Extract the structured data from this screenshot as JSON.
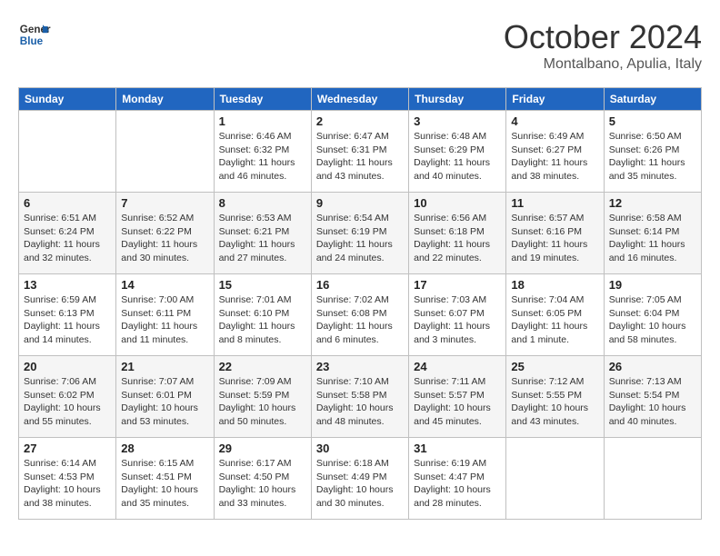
{
  "header": {
    "logo_line1": "General",
    "logo_line2": "Blue",
    "month": "October 2024",
    "location": "Montalbano, Apulia, Italy"
  },
  "days_of_week": [
    "Sunday",
    "Monday",
    "Tuesday",
    "Wednesday",
    "Thursday",
    "Friday",
    "Saturday"
  ],
  "weeks": [
    [
      {
        "day": "",
        "info": ""
      },
      {
        "day": "",
        "info": ""
      },
      {
        "day": "1",
        "info": "Sunrise: 6:46 AM\nSunset: 6:32 PM\nDaylight: 11 hours and 46 minutes."
      },
      {
        "day": "2",
        "info": "Sunrise: 6:47 AM\nSunset: 6:31 PM\nDaylight: 11 hours and 43 minutes."
      },
      {
        "day": "3",
        "info": "Sunrise: 6:48 AM\nSunset: 6:29 PM\nDaylight: 11 hours and 40 minutes."
      },
      {
        "day": "4",
        "info": "Sunrise: 6:49 AM\nSunset: 6:27 PM\nDaylight: 11 hours and 38 minutes."
      },
      {
        "day": "5",
        "info": "Sunrise: 6:50 AM\nSunset: 6:26 PM\nDaylight: 11 hours and 35 minutes."
      }
    ],
    [
      {
        "day": "6",
        "info": "Sunrise: 6:51 AM\nSunset: 6:24 PM\nDaylight: 11 hours and 32 minutes."
      },
      {
        "day": "7",
        "info": "Sunrise: 6:52 AM\nSunset: 6:22 PM\nDaylight: 11 hours and 30 minutes."
      },
      {
        "day": "8",
        "info": "Sunrise: 6:53 AM\nSunset: 6:21 PM\nDaylight: 11 hours and 27 minutes."
      },
      {
        "day": "9",
        "info": "Sunrise: 6:54 AM\nSunset: 6:19 PM\nDaylight: 11 hours and 24 minutes."
      },
      {
        "day": "10",
        "info": "Sunrise: 6:56 AM\nSunset: 6:18 PM\nDaylight: 11 hours and 22 minutes."
      },
      {
        "day": "11",
        "info": "Sunrise: 6:57 AM\nSunset: 6:16 PM\nDaylight: 11 hours and 19 minutes."
      },
      {
        "day": "12",
        "info": "Sunrise: 6:58 AM\nSunset: 6:14 PM\nDaylight: 11 hours and 16 minutes."
      }
    ],
    [
      {
        "day": "13",
        "info": "Sunrise: 6:59 AM\nSunset: 6:13 PM\nDaylight: 11 hours and 14 minutes."
      },
      {
        "day": "14",
        "info": "Sunrise: 7:00 AM\nSunset: 6:11 PM\nDaylight: 11 hours and 11 minutes."
      },
      {
        "day": "15",
        "info": "Sunrise: 7:01 AM\nSunset: 6:10 PM\nDaylight: 11 hours and 8 minutes."
      },
      {
        "day": "16",
        "info": "Sunrise: 7:02 AM\nSunset: 6:08 PM\nDaylight: 11 hours and 6 minutes."
      },
      {
        "day": "17",
        "info": "Sunrise: 7:03 AM\nSunset: 6:07 PM\nDaylight: 11 hours and 3 minutes."
      },
      {
        "day": "18",
        "info": "Sunrise: 7:04 AM\nSunset: 6:05 PM\nDaylight: 11 hours and 1 minute."
      },
      {
        "day": "19",
        "info": "Sunrise: 7:05 AM\nSunset: 6:04 PM\nDaylight: 10 hours and 58 minutes."
      }
    ],
    [
      {
        "day": "20",
        "info": "Sunrise: 7:06 AM\nSunset: 6:02 PM\nDaylight: 10 hours and 55 minutes."
      },
      {
        "day": "21",
        "info": "Sunrise: 7:07 AM\nSunset: 6:01 PM\nDaylight: 10 hours and 53 minutes."
      },
      {
        "day": "22",
        "info": "Sunrise: 7:09 AM\nSunset: 5:59 PM\nDaylight: 10 hours and 50 minutes."
      },
      {
        "day": "23",
        "info": "Sunrise: 7:10 AM\nSunset: 5:58 PM\nDaylight: 10 hours and 48 minutes."
      },
      {
        "day": "24",
        "info": "Sunrise: 7:11 AM\nSunset: 5:57 PM\nDaylight: 10 hours and 45 minutes."
      },
      {
        "day": "25",
        "info": "Sunrise: 7:12 AM\nSunset: 5:55 PM\nDaylight: 10 hours and 43 minutes."
      },
      {
        "day": "26",
        "info": "Sunrise: 7:13 AM\nSunset: 5:54 PM\nDaylight: 10 hours and 40 minutes."
      }
    ],
    [
      {
        "day": "27",
        "info": "Sunrise: 6:14 AM\nSunset: 4:53 PM\nDaylight: 10 hours and 38 minutes."
      },
      {
        "day": "28",
        "info": "Sunrise: 6:15 AM\nSunset: 4:51 PM\nDaylight: 10 hours and 35 minutes."
      },
      {
        "day": "29",
        "info": "Sunrise: 6:17 AM\nSunset: 4:50 PM\nDaylight: 10 hours and 33 minutes."
      },
      {
        "day": "30",
        "info": "Sunrise: 6:18 AM\nSunset: 4:49 PM\nDaylight: 10 hours and 30 minutes."
      },
      {
        "day": "31",
        "info": "Sunrise: 6:19 AM\nSunset: 4:47 PM\nDaylight: 10 hours and 28 minutes."
      },
      {
        "day": "",
        "info": ""
      },
      {
        "day": "",
        "info": ""
      }
    ]
  ]
}
